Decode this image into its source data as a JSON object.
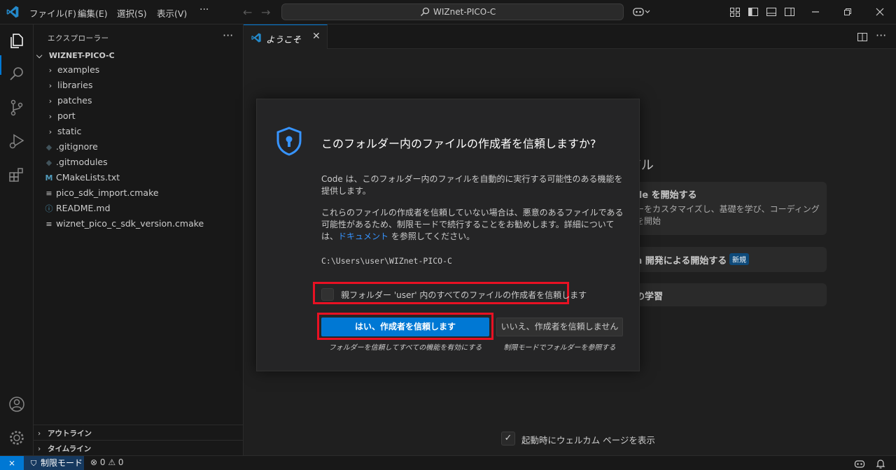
{
  "titlebar": {
    "menus": [
      "ファイル(F)",
      "編集(E)",
      "選択(S)",
      "表示(V)"
    ],
    "more": "···",
    "back": "←",
    "forward": "→",
    "search_text": "WIZnet-PICO-C"
  },
  "sidebar": {
    "title": "エクスプローラー",
    "more": "···",
    "root": "WIZNET-PICO-C",
    "items": [
      {
        "label": "examples",
        "icon": "chevron-right-icon"
      },
      {
        "label": "libraries",
        "icon": "chevron-right-icon"
      },
      {
        "label": "patches",
        "icon": "chevron-right-icon"
      },
      {
        "label": "port",
        "icon": "chevron-right-icon"
      },
      {
        "label": "static",
        "icon": "chevron-right-icon"
      },
      {
        "label": ".gitignore",
        "icon": "git-icon"
      },
      {
        "label": ".gitmodules",
        "icon": "git-icon"
      },
      {
        "label": "CMakeLists.txt",
        "icon": "cmake-icon"
      },
      {
        "label": "pico_sdk_import.cmake",
        "icon": "lines-icon"
      },
      {
        "label": "README.md",
        "icon": "info-icon"
      },
      {
        "label": "wiznet_pico_c_sdk_version.cmake",
        "icon": "lines-icon"
      }
    ],
    "outline": "アウトライン",
    "timeline": "タイムライン"
  },
  "tab": {
    "label": "ようこそ",
    "close": "✕"
  },
  "welcome": {
    "heading_fragment": "アル",
    "card1_title": "de を開始する",
    "card1_desc": "ーをカスタマイズし、基礎を学び、コーディングを開始",
    "card2_title": "n 開発による開始する",
    "card2_badge": "新規",
    "card3_title": "の学習",
    "show_on_startup": "起動時にウェルカム ページを表示"
  },
  "dialog": {
    "title": "このフォルダー内のファイルの作成者を信頼しますか?",
    "para1": "Code は、このフォルダー内のファイルを自動的に実行する可能性のある機能を提供します。",
    "para2_before_link": "これらのファイルの作成者を信頼していない場合は、悪意のあるファイルである可能性があるため、制限モードで続行することをお勧めします。詳細については、",
    "para2_link": "ドキュメント",
    "para2_after_link": " を参照してください。",
    "path": "C:\\Users\\user\\WIZnet-PICO-C",
    "checkbox_label": "親フォルダー 'user' 内のすべてのファイルの作成者を信頼します",
    "trust_button": "はい、作成者を信頼します",
    "trust_note": "フォルダーを信頼してすべての機能を有効にする",
    "distrust_button": "いいえ、作成者を信頼しません",
    "distrust_note": "制限モードでフォルダーを参照する"
  },
  "statusbar": {
    "remote": "⨯",
    "restricted": "制限モード",
    "problems": "⊗ 0 ⚠ 0"
  },
  "colors": {
    "accent": "#0078d4",
    "highlight": "#e81123",
    "link": "#3794ff"
  }
}
